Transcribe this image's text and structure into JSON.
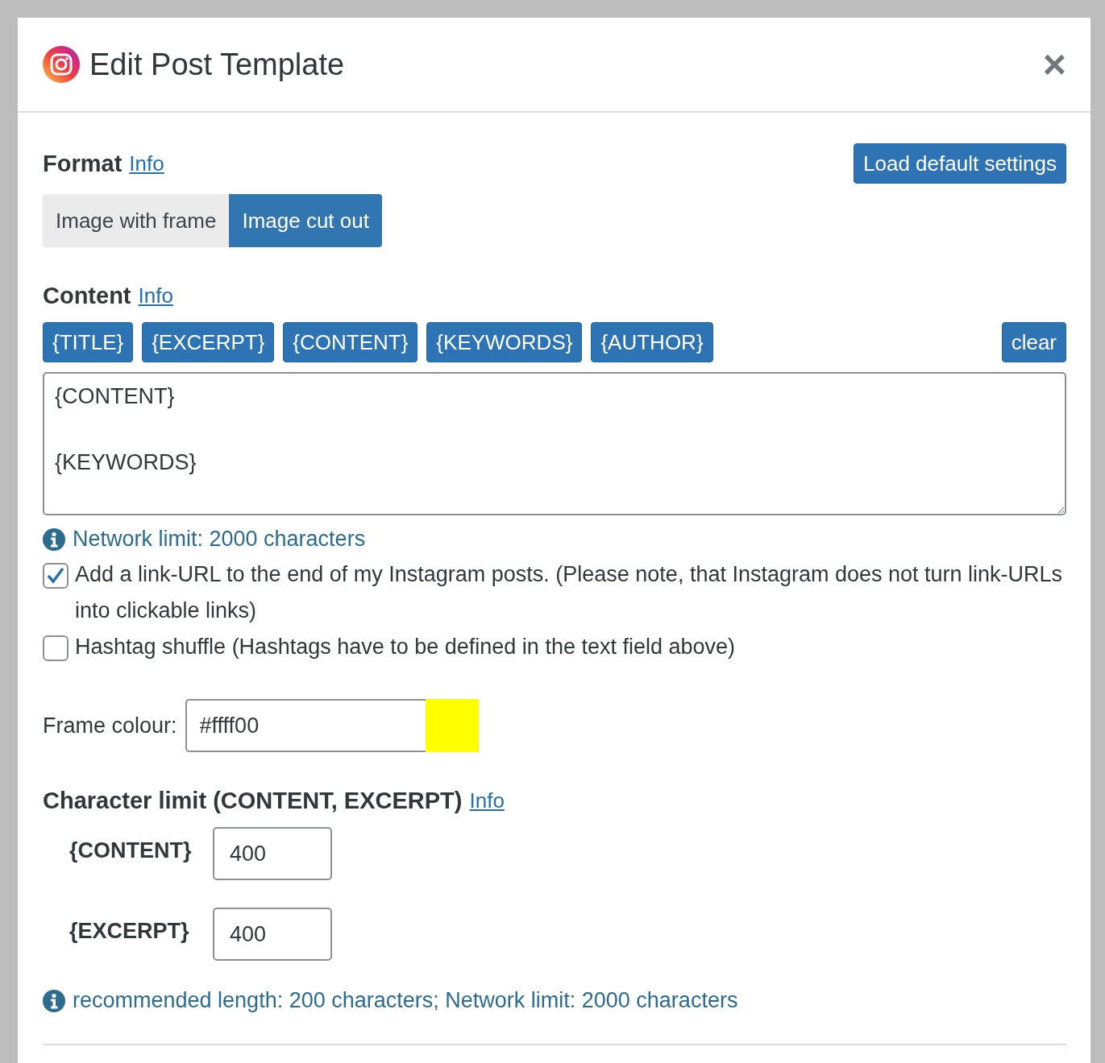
{
  "dialog": {
    "title": "Edit Post Template",
    "close": "×"
  },
  "format": {
    "heading": "Format",
    "info": "Info",
    "load_button": "Load default settings",
    "options": [
      {
        "label": "Image with frame",
        "selected": false
      },
      {
        "label": "Image cut out",
        "selected": true
      }
    ]
  },
  "content": {
    "heading": "Content",
    "info": "Info",
    "tags": [
      "{TITLE}",
      "{EXCERPT}",
      "{CONTENT}",
      "{KEYWORDS}",
      "{AUTHOR}"
    ],
    "clear_button": "clear",
    "value": "{CONTENT}\n\n{KEYWORDS}",
    "note": "Network limit: 2000 characters"
  },
  "options": [
    {
      "label": "Add a link-URL to the end of my Instagram posts. (Please note, that Instagram does not turn link-URLs into clickable links)",
      "checked": true
    },
    {
      "label": "Hashtag shuffle (Hashtags have to be defined in the text field above)",
      "checked": false
    }
  ],
  "frame_colour": {
    "label": "Frame colour:",
    "value": "#ffff00",
    "color": "#ffff00"
  },
  "char_limit": {
    "heading": "Character limit (CONTENT, EXCERPT)",
    "info": "Info",
    "fields": [
      {
        "label": "{CONTENT}",
        "value": "400"
      },
      {
        "label": "{EXCERPT}",
        "value": "400"
      }
    ],
    "note": "recommended length: 200 characters; Network limit: 2000 characters"
  }
}
